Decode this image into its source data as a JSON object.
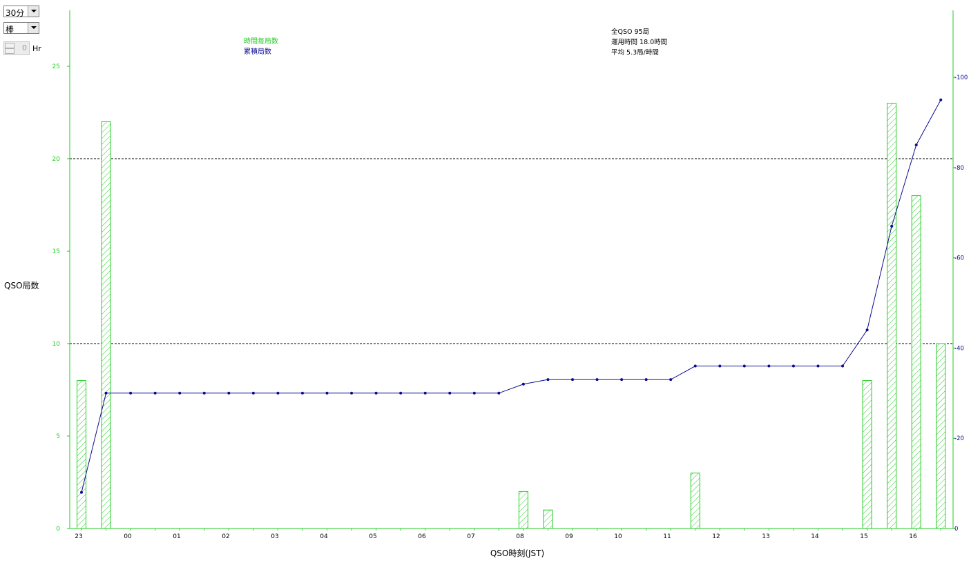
{
  "controls": {
    "interval": "30分",
    "chart_style": "棒",
    "offset_value": "0",
    "offset_unit": "Hr"
  },
  "legend": {
    "per_hour": "時間毎局数",
    "cumulative": "累積局数"
  },
  "summary": {
    "total": "全QSO 95局",
    "duration": "運用時間 18.0時間",
    "average": "平均 5.3局/時間"
  },
  "colors": {
    "bar": "#22cc22",
    "line": "#0b0b8f",
    "left_axis": "#22cc22",
    "right_axis": "#0b0b8f"
  },
  "chart_data": {
    "type": "bar",
    "xlabel": "QSO時刻(JST)",
    "ylabel": "QSO局数",
    "x_ticks": [
      "23",
      "00",
      "01",
      "02",
      "03",
      "04",
      "05",
      "06",
      "07",
      "08",
      "09",
      "10",
      "11",
      "12",
      "13",
      "14",
      "15",
      "16"
    ],
    "left_ticks": [
      "0",
      "5",
      "10",
      "15",
      "20",
      "25"
    ],
    "right_ticks": [
      "0",
      "20",
      "40",
      "60",
      "80",
      "100"
    ],
    "ylim_left": [
      0,
      28.5
    ],
    "ylim_right": [
      0,
      114
    ],
    "gridlines_left": [
      10,
      20
    ],
    "categories": [
      "23:00",
      "23:30",
      "00:00",
      "00:30",
      "01:00",
      "01:30",
      "02:00",
      "02:30",
      "03:00",
      "03:30",
      "04:00",
      "04:30",
      "05:00",
      "05:30",
      "06:00",
      "06:30",
      "07:00",
      "07:30",
      "08:00",
      "08:30",
      "09:00",
      "09:30",
      "10:00",
      "10:30",
      "11:00",
      "11:30",
      "12:00",
      "12:30",
      "13:00",
      "13:30",
      "14:00",
      "14:30",
      "15:00",
      "15:30",
      "16:00",
      "16:30"
    ],
    "series": [
      {
        "name": "時間毎局数",
        "axis": "left",
        "kind": "bar",
        "values": [
          8,
          22,
          0,
          0,
          0,
          0,
          0,
          0,
          0,
          0,
          0,
          0,
          0,
          0,
          0,
          0,
          0,
          0,
          2,
          1,
          0,
          0,
          0,
          0,
          0,
          3,
          0,
          0,
          0,
          0,
          0,
          0,
          8,
          23,
          18,
          10
        ]
      },
      {
        "name": "累積局数",
        "axis": "right",
        "kind": "line",
        "values": [
          8,
          30,
          30,
          30,
          30,
          30,
          30,
          30,
          30,
          30,
          30,
          30,
          30,
          30,
          30,
          30,
          30,
          30,
          32,
          33,
          33,
          33,
          33,
          33,
          33,
          36,
          36,
          36,
          36,
          36,
          36,
          36,
          44,
          67,
          85,
          95
        ]
      }
    ]
  }
}
